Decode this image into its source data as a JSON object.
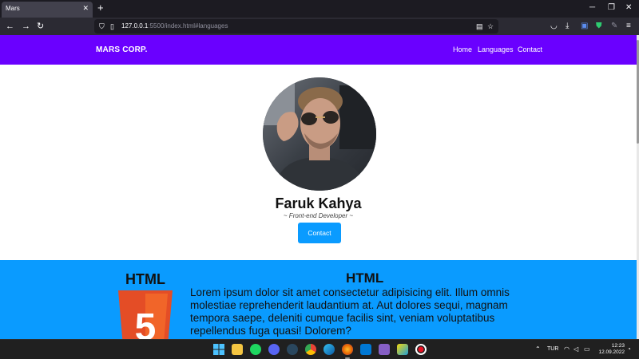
{
  "browser": {
    "tab_title": "Mars",
    "tab_close_icon": "close-icon",
    "new_tab_icon": "plus-icon",
    "url_host": "127.0.0.1",
    "url_rest": ":5500/index.html#languages"
  },
  "site": {
    "brand": "MARS CORP.",
    "nav": [
      "Home",
      "Languages",
      "Contact"
    ],
    "header_color": "#6a00ff",
    "accent_color": "#0a9bff"
  },
  "profile": {
    "name": "Faruk Kahya",
    "role": "~ Front-end Developer ~",
    "contact_label": "Contact"
  },
  "languages": {
    "logo_label": "HTML",
    "logo_digit": "5",
    "title": "HTML",
    "description": "Lorem ipsum dolor sit amet consectetur adipisicing elit. Illum omnis molestiae reprehenderit laudantium at. Aut dolores sequi, magnam tempora saepe, deleniti cumque facilis sint, veniam voluptatibus repellendus fuga quasi! Dolorem?"
  },
  "taskbar": {
    "language": "TUR",
    "time": "12:23",
    "date": "12.09.2022"
  }
}
